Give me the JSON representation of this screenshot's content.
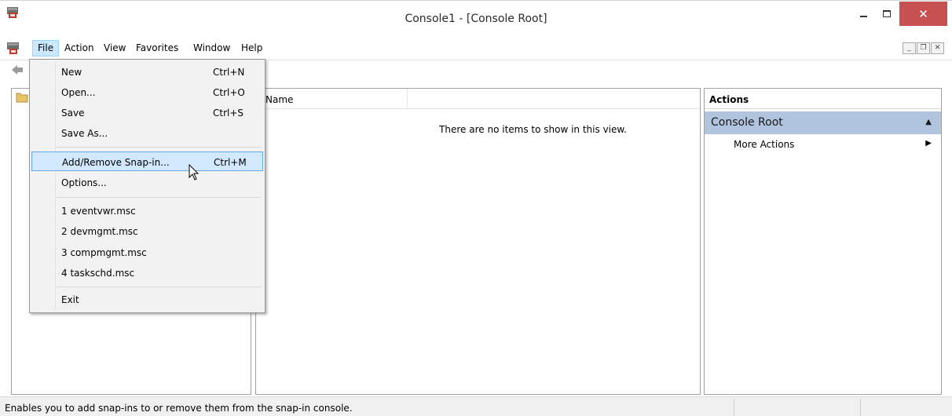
{
  "window": {
    "title": "Console1 - [Console Root]",
    "close_color": "#c75050"
  },
  "menubar": {
    "items": [
      {
        "label": "File",
        "active": true
      },
      {
        "label": "Action"
      },
      {
        "label": "View"
      },
      {
        "label": "Favorites"
      },
      {
        "label": "Window"
      },
      {
        "label": "Help"
      }
    ]
  },
  "file_menu": {
    "items": [
      {
        "label": "New",
        "shortcut": "Ctrl+N"
      },
      {
        "label": "Open...",
        "shortcut": "Ctrl+O"
      },
      {
        "label": "Save",
        "shortcut": "Ctrl+S"
      },
      {
        "label": "Save As...",
        "shortcut": ""
      },
      {
        "label": "Add/Remove Snap-in...",
        "shortcut": "Ctrl+M",
        "highlighted": true
      },
      {
        "label": "Options...",
        "shortcut": ""
      },
      {
        "label": "1 eventvwr.msc",
        "shortcut": ""
      },
      {
        "label": "2 devmgmt.msc",
        "shortcut": ""
      },
      {
        "label": "3 compmgmt.msc",
        "shortcut": ""
      },
      {
        "label": "4 taskschd.msc",
        "shortcut": ""
      },
      {
        "label": "Exit",
        "shortcut": ""
      }
    ]
  },
  "list_pane": {
    "column_name": "Name",
    "empty_message": "There are no items to show in this view."
  },
  "actions_pane": {
    "header": "Actions",
    "section_title": "Console Root",
    "section_color": "#b0c4de",
    "more_actions": "More Actions"
  },
  "statusbar": {
    "text": "Enables you to add snap-ins to or remove them from the snap-in console."
  }
}
